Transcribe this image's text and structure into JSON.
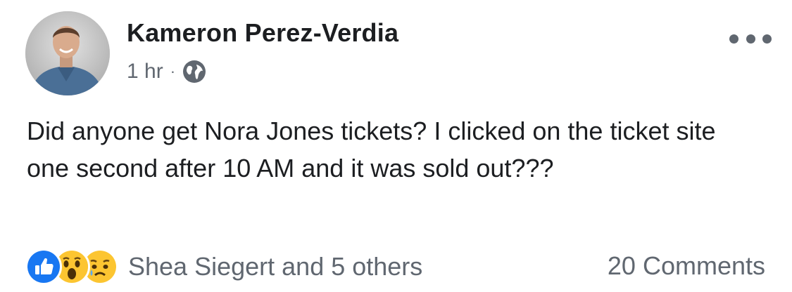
{
  "post": {
    "author": "Kameron Perez-Verdia",
    "timestamp": "1 hr",
    "separator": "·",
    "privacy_icon": "globe-icon",
    "more_icon": "more-options-icon",
    "text": "Did anyone get Nora Jones tickets? I clicked on the ticket site one second after 10 AM and it was sold out???",
    "reactions": {
      "icons": [
        "like-reaction-icon",
        "wow-reaction-icon",
        "sad-reaction-icon"
      ],
      "summary": "Shea Siegert and 5 others"
    },
    "comments": "20 Comments"
  },
  "colors": {
    "text_primary": "#1c1e21",
    "text_secondary": "#606770",
    "like_blue": "#1877f2",
    "emoji_yellow": "#fcc531",
    "background": "#ffffff"
  }
}
